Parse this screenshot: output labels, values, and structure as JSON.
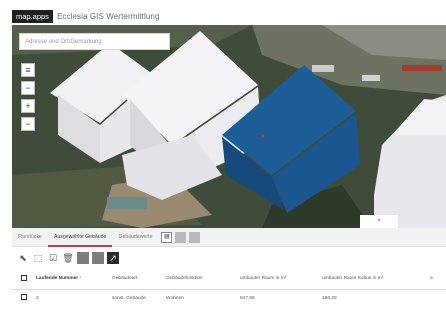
{
  "header": {
    "logo": "map.apps",
    "title": "Ecclesia GIS Wertermittlung"
  },
  "map": {
    "search_placeholder": "Adresse und Ort/Gemarkung",
    "tools": [
      "≡",
      "−",
      "+",
      "−"
    ],
    "colors": {
      "selected_building": "#1b5a93",
      "buildings": "#e9e9ec",
      "ground": "#3f4a38"
    }
  },
  "panel": {
    "tabs": [
      "Flurstücke",
      "Ausgewählte Gebäude",
      "Gebäudewerte"
    ],
    "active_tab": 1,
    "toolbar_icons": [
      "select-arrow-icon",
      "select-box-icon",
      "check-icon",
      "trash-icon",
      "gray-tool-icon",
      "gray-tool-icon",
      "chart-icon"
    ],
    "table": {
      "columns": [
        "Laufende Nummer ↑",
        "Gebäudeart",
        "Gebäudefunktion",
        "umbauter Raum in m³",
        "umbauter Raum Kubus in m³",
        "a"
      ],
      "rows": [
        [
          "2",
          "sonst. Gebäude",
          "Wohnen",
          "847,59",
          "186,29",
          ""
        ]
      ]
    },
    "accent": "#c9365f"
  }
}
